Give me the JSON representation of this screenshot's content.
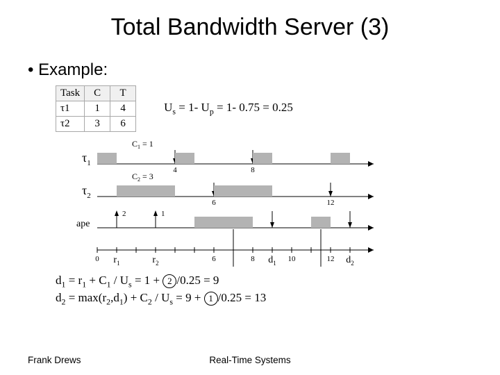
{
  "title": "Total Bandwidth Server (3)",
  "bullet": "Example:",
  "table": {
    "head": {
      "task": "Task",
      "c": "C",
      "t": "T"
    },
    "rows": [
      {
        "task": "τ1",
        "c": "1",
        "t": "4"
      },
      {
        "task": "τ2",
        "c": "3",
        "t": "6"
      }
    ]
  },
  "formula_us": {
    "lhs": "U",
    "sub1": "s",
    "mid": " = 1- U",
    "sub2": "p",
    "rhs": " = 1- 0.75 = 0.25"
  },
  "diagram": {
    "line1_labels": {
      "tau": "τ",
      "idx": "1",
      "ann": "C",
      "annidx": "1",
      "annval": " = 1"
    },
    "line1_ticks": {
      "t4": "4",
      "t8": "8"
    },
    "line2_labels": {
      "tau": "τ",
      "idx": "2",
      "ann": "C",
      "annidx": "2",
      "annval": " = 3"
    },
    "line2_ticks": {
      "t6": "6",
      "t12": "12"
    },
    "line3_labels": {
      "lbl": "ape",
      "a2": "2",
      "a1": "1"
    },
    "bottom_ticks": {
      "t0": "0",
      "t6": "6",
      "t8": "8",
      "t10": "10",
      "t12": "12"
    },
    "r1": "r",
    "r1i": "1",
    "r2": "r",
    "r2i": "2",
    "d1": "d",
    "d1i": "1",
    "d2": "d",
    "d2i": "2"
  },
  "eq1": {
    "lhs": "d",
    "lhsi": "1",
    "eq": " = r",
    "ri": "1",
    "plus": " + C",
    "ci": "1",
    "over": " / U",
    "ui": "s",
    "val": " = 1 + ",
    "circ": "2",
    "rest": "/0.25 = 9"
  },
  "eq2": {
    "lhs": "d",
    "lhsi": "2",
    "eq": " = max(r",
    "ri": "2",
    "comma": ",d",
    "di": "1",
    "close": ") + C",
    "ci": "2",
    "over": " / U",
    "ui": "s",
    "val": " = 9 + ",
    "circ": "1",
    "rest": "/0.25 = 13"
  },
  "footer": {
    "left": "Frank Drews",
    "mid": "Real-Time Systems"
  },
  "chart_data": {
    "type": "table",
    "title": "Total Bandwidth Server example",
    "tasks": [
      {
        "name": "τ1",
        "C": 1,
        "T": 4
      },
      {
        "name": "τ2",
        "C": 3,
        "T": 6
      }
    ],
    "Up": 0.75,
    "Us": 0.25,
    "aperiodics": [
      {
        "label": "ape",
        "arrival": 1,
        "cost": 2
      },
      {
        "label": "ape",
        "arrival": 3,
        "cost": 1
      }
    ],
    "deadlines": {
      "d1": 9,
      "d2": 13
    },
    "timelines": {
      "τ1": {
        "blocks": [
          [
            0,
            1
          ],
          [
            4,
            5
          ],
          [
            8,
            9
          ],
          [
            12,
            13
          ]
        ],
        "deadlines_at": [
          4,
          8,
          12
        ]
      },
      "τ2": {
        "blocks": [
          [
            1,
            4
          ],
          [
            6,
            9
          ]
        ],
        "deadlines_at": [
          6,
          12
        ]
      },
      "ape": {
        "blocks": [
          [
            5,
            6
          ],
          [
            6,
            8
          ],
          [
            11,
            12
          ]
        ]
      }
    },
    "x_range": [
      0,
      14
    ]
  }
}
